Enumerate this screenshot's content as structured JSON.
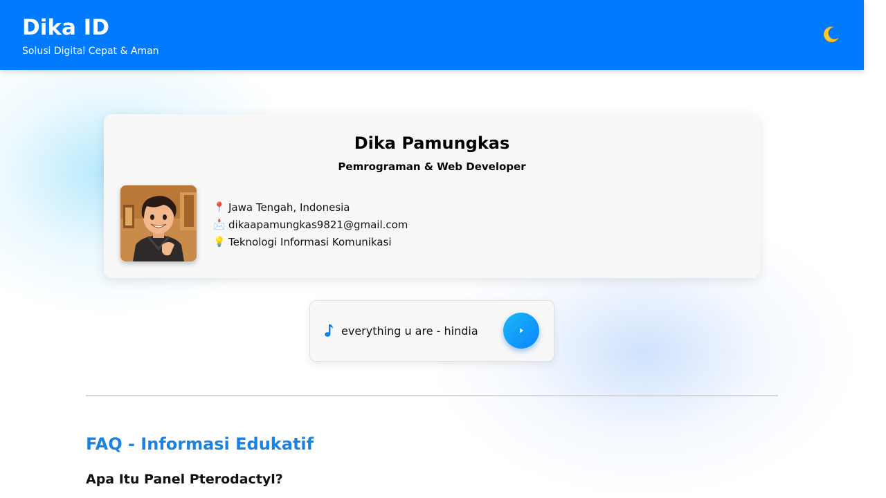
{
  "header": {
    "title": "Dika ID",
    "tagline": "Solusi Digital Cepat & Aman",
    "theme_toggle_icon": "moon-icon",
    "background_color": "#007bff"
  },
  "profile": {
    "name": "Dika Pamungkas",
    "role": "Pemrograman & Web Developer",
    "avatar_icon": "avatar",
    "info": [
      {
        "icon": "pin-icon",
        "text": "Jawa Tengah, Indonesia"
      },
      {
        "icon": "envelope-icon",
        "text": "dikaapamungkas9821@gmail.com"
      },
      {
        "icon": "lightbulb-icon",
        "text": "Teknologi Informasi Komunikasi"
      }
    ]
  },
  "music_player": {
    "song_title": "everything u are - hindia",
    "note_icon": "music-note-icon",
    "play_icon": "play-icon",
    "accent_color": "#0a84ff"
  },
  "faq": {
    "heading": "FAQ - Informasi Edukatif",
    "heading_color": "#1a82e2",
    "questions": [
      {
        "question": "Apa Itu Panel Pterodactyl?"
      }
    ]
  }
}
